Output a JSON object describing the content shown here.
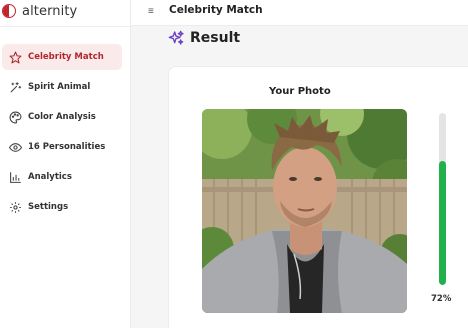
{
  "app": {
    "logo_text": "alternity",
    "brand_color": "#c0262d"
  },
  "sidebar": {
    "items": [
      {
        "label": "Celebrity Match",
        "icon": "star-icon",
        "active": true
      },
      {
        "label": "Spirit Animal",
        "icon": "sparkle-tool-icon",
        "active": false
      },
      {
        "label": "Color Analysis",
        "icon": "palette-icon",
        "active": false
      },
      {
        "label": "16 Personalities",
        "icon": "eye-icon",
        "active": false
      },
      {
        "label": "Analytics",
        "icon": "bar-chart-icon",
        "active": false
      },
      {
        "label": "Settings",
        "icon": "gear-icon",
        "active": false
      }
    ]
  },
  "header": {
    "menu_icon": "hamburger-icon",
    "title": "Celebrity Match"
  },
  "main": {
    "result_icon": "sparkles-icon",
    "result_title": "Result",
    "photo_label": "Your Photo",
    "match_percent": 72,
    "match_label": "72%",
    "progress_color": "#22b04b",
    "accent_color": "#6a3fc2"
  }
}
